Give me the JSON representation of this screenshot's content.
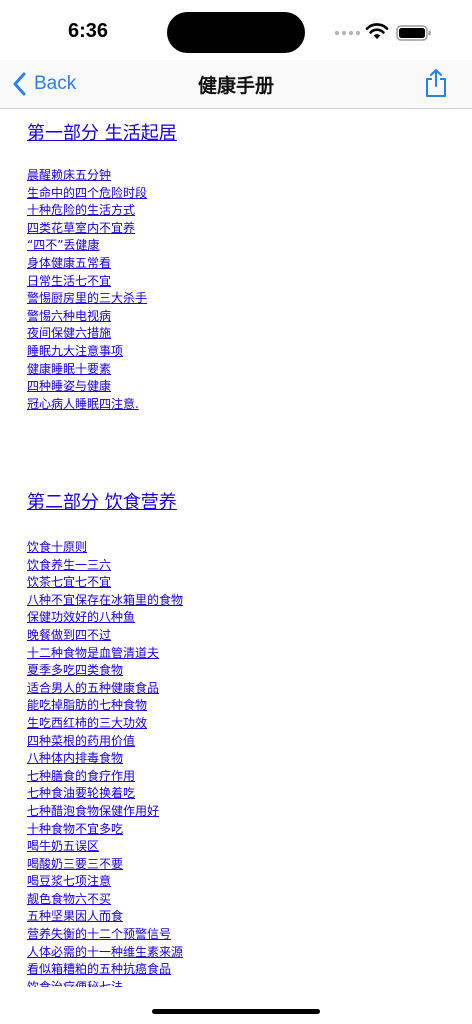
{
  "status_bar": {
    "time": "6:36"
  },
  "nav": {
    "back_label": "Back",
    "title": "健康手册"
  },
  "sections": [
    {
      "title": "第一部分 生活起居",
      "items": [
        "晨醒赖床五分钟",
        "生命中的四个危险时段",
        "十种危险的生活方式",
        "四类花草室内不宜养",
        "“四不”丢健康",
        "身体健康五常看",
        "日常生活七不宜",
        "警惕厨房里的三大杀手",
        "警惕六种电视病",
        "夜间保健六措施",
        "睡眠九大注意事项",
        "健康睡眠十要素",
        "四种睡姿与健康",
        "冠心病人睡眠四注意."
      ]
    },
    {
      "title": "第二部分 饮食营养",
      "items": [
        "饮食十原则",
        "饮食养生一三六",
        "饮茶七宜七不宜",
        "八种不宜保存在冰箱里的食物",
        "保健功效好的八种鱼",
        "晚餐做到四不过",
        "十二种食物是血管清道夫",
        "夏季多吃四类食物",
        "适合男人的五种健康食品",
        "能吃掉脂肪的七种食物",
        "生吃西红柿的三大功效",
        "四种菜根的药用价值",
        "八种体内排毒食物",
        "七种膳食的食疗作用",
        "七种食油要轮换着吃",
        "七种醋泡食物保健作用好",
        "十种食物不宜多吃",
        "喝牛奶五误区",
        "喝酸奶三要三不要",
        "喝豆浆七项注意",
        "靓色食物六不买",
        "五种坚果因人而食",
        "营养失衡的十二个预警信号",
        "人体必需的十一种维生素来源",
        "看似箱糟粕的五种抗癌食品",
        "饮食治疗便秘七法"
      ]
    }
  ]
}
